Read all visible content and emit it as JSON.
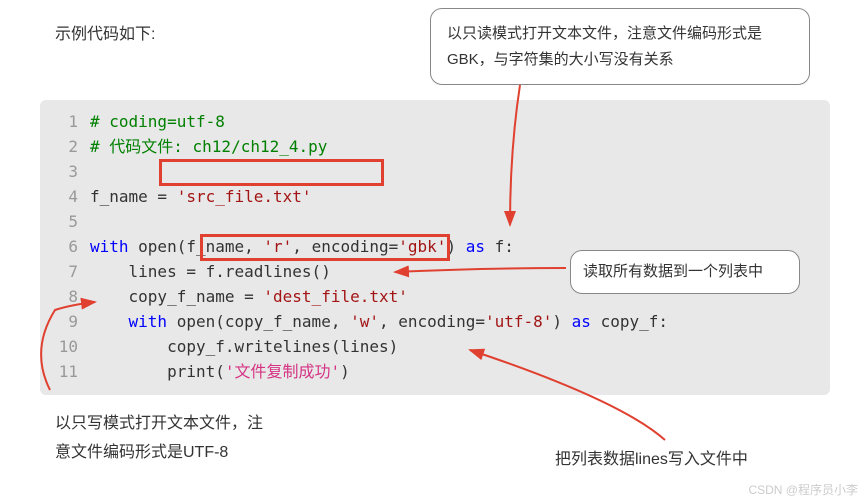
{
  "title": "示例代码如下:",
  "callouts": {
    "top": "以只读模式打开文本文件，注意文件编码形式是GBK，与字符集的大小写没有关系",
    "right": "读取所有数据到一个列表中"
  },
  "notes": {
    "bottom_left_l1": "以只写模式打开文本文件，注",
    "bottom_left_l2": "意文件编码形式是UTF-8",
    "bottom_right": "把列表数据lines写入文件中"
  },
  "code": {
    "lines": [
      {
        "num": "1",
        "content": [
          {
            "t": "# coding=utf-8",
            "cls": "c-comment"
          }
        ]
      },
      {
        "num": "2",
        "content": [
          {
            "t": "# 代码文件: ch12/ch12_4.py",
            "cls": "c-comment"
          }
        ]
      },
      {
        "num": "3",
        "content": []
      },
      {
        "num": "4",
        "content": [
          {
            "t": "f_name = ",
            "cls": "c-default"
          },
          {
            "t": "'src_file.txt'",
            "cls": "c-string"
          }
        ]
      },
      {
        "num": "5",
        "content": []
      },
      {
        "num": "6",
        "fold": true,
        "content": [
          {
            "t": "with",
            "cls": "c-keyword"
          },
          {
            "t": " open(f_name, ",
            "cls": "c-default"
          },
          {
            "t": "'r'",
            "cls": "c-string"
          },
          {
            "t": ", encoding=",
            "cls": "c-default"
          },
          {
            "t": "'gbk'",
            "cls": "c-string"
          },
          {
            "t": ") ",
            "cls": "c-default"
          },
          {
            "t": "as",
            "cls": "c-keyword"
          },
          {
            "t": " f:",
            "cls": "c-default"
          }
        ]
      },
      {
        "num": "7",
        "content": [
          {
            "t": "    lines = f.readlines()",
            "cls": "c-default"
          }
        ]
      },
      {
        "num": "8",
        "content": [
          {
            "t": "    copy_f_name = ",
            "cls": "c-default"
          },
          {
            "t": "'dest_file.txt'",
            "cls": "c-string"
          }
        ]
      },
      {
        "num": "9",
        "fold": true,
        "content": [
          {
            "t": "    ",
            "cls": "c-default"
          },
          {
            "t": "with",
            "cls": "c-keyword"
          },
          {
            "t": " open(copy_f_name, ",
            "cls": "c-default"
          },
          {
            "t": "'w'",
            "cls": "c-string"
          },
          {
            "t": ", encoding=",
            "cls": "c-default"
          },
          {
            "t": "'utf-8'",
            "cls": "c-string"
          },
          {
            "t": ") ",
            "cls": "c-default"
          },
          {
            "t": "as",
            "cls": "c-keyword"
          },
          {
            "t": " copy_f:",
            "cls": "c-default"
          }
        ]
      },
      {
        "num": "10",
        "content": [
          {
            "t": "        copy_f.writelines(lines)",
            "cls": "c-default"
          }
        ]
      },
      {
        "num": "11",
        "content": [
          {
            "t": "        print(",
            "cls": "c-default"
          },
          {
            "t": "'文件复制成功'",
            "cls": "c-string-cn"
          },
          {
            "t": ")",
            "cls": "c-default"
          }
        ]
      }
    ]
  },
  "watermark": "CSDN @程序员小李"
}
